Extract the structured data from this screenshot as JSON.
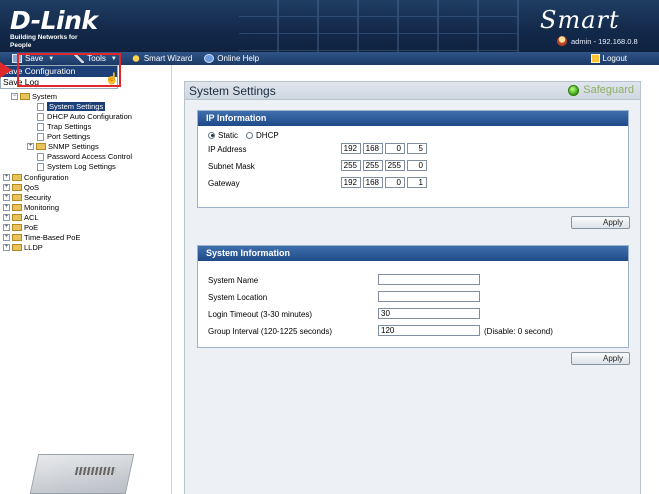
{
  "header": {
    "brand": "D-Link",
    "tagline": "Building Networks for People",
    "product": "Smart",
    "user_info": "admin - 192.168.0.8"
  },
  "toolbar": {
    "save_label": "Save",
    "tools_label": "Tools",
    "wizard_label": "Smart Wizard",
    "help_label": "Online Help",
    "logout_label": "Logout"
  },
  "save_menu": {
    "items": [
      "Save Configuration",
      "Save Log"
    ]
  },
  "sidebar": {
    "nodes": [
      {
        "label": "System",
        "kind": "folder",
        "expander": "−"
      },
      {
        "label": "System Settings",
        "kind": "doc"
      },
      {
        "label": "DHCP Auto Configuration",
        "kind": "doc"
      },
      {
        "label": "Trap Settings",
        "kind": "doc"
      },
      {
        "label": "Port Settings",
        "kind": "doc"
      },
      {
        "label": "SNMP Settings",
        "kind": "folder",
        "expander": "+"
      },
      {
        "label": "Password Access Control",
        "kind": "doc"
      },
      {
        "label": "System Log Settings",
        "kind": "doc"
      },
      {
        "label": "Configuration",
        "kind": "folder",
        "expander": "+"
      },
      {
        "label": "QoS",
        "kind": "folder",
        "expander": "+"
      },
      {
        "label": "Security",
        "kind": "folder",
        "expander": "+"
      },
      {
        "label": "Monitoring",
        "kind": "folder",
        "expander": "+"
      },
      {
        "label": "ACL",
        "kind": "folder",
        "expander": "+"
      },
      {
        "label": "PoE",
        "kind": "folder",
        "expander": "+"
      },
      {
        "label": "Time-Based PoE",
        "kind": "folder",
        "expander": "+"
      },
      {
        "label": "LLDP",
        "kind": "folder",
        "expander": "+"
      }
    ]
  },
  "panel": {
    "title": "System Settings",
    "safeguard_label": "Safeguard"
  },
  "ip_info": {
    "heading": "IP Information",
    "static_label": "Static",
    "dhcp_label": "DHCP",
    "selected_mode": "Static",
    "ip_label": "IP Address",
    "ip": [
      "192",
      "168",
      "0",
      "5"
    ],
    "mask_label": "Subnet Mask",
    "mask": [
      "255",
      "255",
      "255",
      "0"
    ],
    "gateway_label": "Gateway",
    "gateway": [
      "192",
      "168",
      "0",
      "1"
    ],
    "apply_label": "Apply"
  },
  "sys_info": {
    "heading": "System Information",
    "name_label": "System Name",
    "name_value": "",
    "location_label": "System Location",
    "location_value": "",
    "timeout_label": "Login Timeout (3-30 minutes)",
    "timeout_value": "30",
    "group_label": "Group Interval (120-1225 seconds)",
    "group_value": "120",
    "group_hint": "(Disable: 0 second)",
    "apply_label": "Apply"
  },
  "colors": {
    "header_bg": "#13294a",
    "accent": "#1f4a88",
    "highlight": "#e0282c",
    "safeguard": "#8bb062"
  }
}
